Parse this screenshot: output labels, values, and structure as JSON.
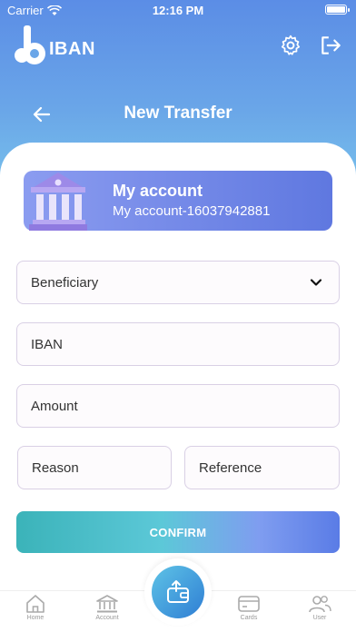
{
  "status_bar": {
    "carrier": "Carrier",
    "time": "12:16 PM"
  },
  "header": {
    "logo_text": "IBAN",
    "title": "New Transfer"
  },
  "account": {
    "name": "My account",
    "number": "My account-16037942881"
  },
  "form": {
    "beneficiary": "Beneficiary",
    "iban": "IBAN",
    "amount": "Amount",
    "reason": "Reason",
    "reference": "Reference",
    "confirm": "CONFIRM"
  },
  "tabs": [
    {
      "label": "Home",
      "icon": "home-icon"
    },
    {
      "label": "Account",
      "icon": "bank-icon"
    },
    {
      "label": "Cards",
      "icon": "card-icon"
    },
    {
      "label": "User",
      "icon": "users-icon"
    }
  ],
  "colors": {
    "hero_top": "#5b8de6",
    "hero_bottom": "#79c4ec",
    "accent": "#5f78e0",
    "confirm_start": "#3bb3b9"
  }
}
